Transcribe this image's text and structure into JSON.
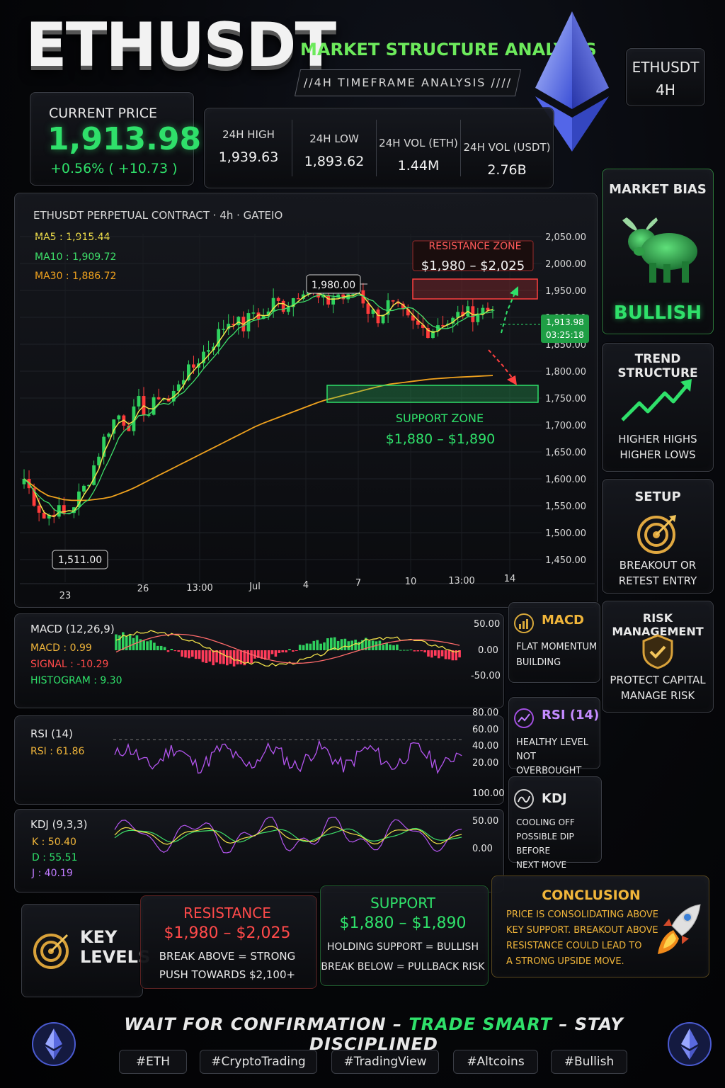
{
  "header": {
    "title": "ETHUSDT",
    "subtitle": "MARKET STRUCTURE ANALYSIS",
    "timeframe_banner": "//4H TIMEFRAME ANALYSIS ////",
    "pair_box": {
      "pair": "ETHUSDT",
      "interval": "4H"
    }
  },
  "price": {
    "label": "CURRENT PRICE",
    "value": "1,913.98",
    "change": "+0.56% ( +10.73 )"
  },
  "stats": [
    {
      "label": "24H HIGH",
      "value": "1,939.63"
    },
    {
      "label": "24H LOW",
      "value": "1,893.62"
    },
    {
      "label": "24H VOL (ETH)",
      "value": "1.44M"
    },
    {
      "label": "24H VOL (USDT)",
      "value": "2.76B"
    }
  ],
  "main_chart": {
    "header": "ETHUSDT PERPETUAL CONTRACT · 4h · GATEIO",
    "ma5": "MA5 : 1,915.44",
    "ma10": "MA10 : 1,909.72",
    "ma30": "MA30 : 1,886.72",
    "resistance_label": "RESISTANCE ZONE",
    "resistance_range": "$1,980 – $2,025",
    "support_label": "SUPPORT ZONE",
    "support_range": "$1,880 – $1,890",
    "high_callout": "1,980.00",
    "low_callout": "1,511.00",
    "price_tag": "1,913.98",
    "countdown": "03:25:18",
    "colors": {
      "up": "#2fd15e",
      "down": "#ff3b3b",
      "ma5": "#f2e14a",
      "ma10": "#3ee06a",
      "ma30": "#f0a21e"
    }
  },
  "chart_data": [
    {
      "type": "candlestick",
      "title": "ETHUSDT PERPETUAL CONTRACT · 4h · GATEIO",
      "x_tick_labels": [
        "23",
        "26",
        "13:00",
        "Jul",
        "4",
        "7",
        "10",
        "13:00",
        "14"
      ],
      "y_tick_labels": [
        "2,050.00",
        "2,000.00",
        "1,950.00",
        "1,900.00",
        "1,850.00",
        "1,800.00",
        "1,750.00",
        "1,700.00",
        "1,650.00",
        "1,600.00",
        "1,550.00",
        "1,500.00",
        "1,450.00"
      ],
      "ylim": [
        1450,
        2050
      ],
      "close_path": [
        1600,
        1560,
        1525,
        1545,
        1530,
        1560,
        1590,
        1640,
        1690,
        1720,
        1700,
        1740,
        1720,
        1760,
        1740,
        1790,
        1800,
        1830,
        1850,
        1880,
        1900,
        1880,
        1910,
        1900,
        1930,
        1920,
        1940,
        1960,
        1935,
        1925,
        1945,
        1930,
        1955,
        1915,
        1900,
        1925,
        1910,
        1890,
        1880,
        1875,
        1895,
        1890,
        1910,
        1905,
        1915,
        1914
      ],
      "ma30_path": [
        1600,
        1570,
        1560,
        1560,
        1565,
        1580,
        1600,
        1620,
        1640,
        1660,
        1680,
        1700,
        1715,
        1730,
        1745,
        1755,
        1765,
        1775,
        1780,
        1785,
        1788,
        1790,
        1792
      ],
      "annotations": {
        "high": 1980,
        "low": 1511,
        "last": 1913.98
      },
      "resistance_zone": [
        1980,
        2025
      ],
      "support_zone": [
        1880,
        1890
      ]
    },
    {
      "type": "line",
      "title": "MACD (12,26,9)",
      "series": [
        {
          "name": "MACD",
          "value": 0.99
        },
        {
          "name": "SIGNAL",
          "value": -10.29
        },
        {
          "name": "HISTOGRAM",
          "value": 9.3
        }
      ],
      "y_tick_labels": [
        "50.00",
        "0.00",
        "-50.00"
      ],
      "ylim": [
        -50,
        50
      ]
    },
    {
      "type": "line",
      "title": "RSI (14)",
      "series": [
        {
          "name": "RSI",
          "value": 61.86
        }
      ],
      "y_tick_labels": [
        "80.00",
        "60.00",
        "40.00",
        "20.00"
      ],
      "ylim": [
        20,
        80
      ]
    },
    {
      "type": "line",
      "title": "KDJ (9,3,3)",
      "series": [
        {
          "name": "K",
          "value": 50.4
        },
        {
          "name": "D",
          "value": 55.51
        },
        {
          "name": "J",
          "value": 40.19
        }
      ],
      "y_tick_labels": [
        "100.00",
        "50.00",
        "0.00"
      ],
      "ylim": [
        0,
        100
      ]
    }
  ],
  "indicators": {
    "macd": {
      "title": "MACD (12,26,9)",
      "macd": "MACD : 0.99",
      "signal": "SIGNAL : -10.29",
      "hist": "HISTOGRAM : 9.30",
      "card_title": "MACD",
      "card_text": [
        "FLAT MOMENTUM",
        "BUILDING"
      ]
    },
    "rsi": {
      "title": "RSI (14)",
      "rsi": "RSI : 61.86",
      "card_title": "RSI (14)",
      "card_text": [
        "HEALTHY LEVEL",
        "NOT OVERBOUGHT"
      ]
    },
    "kdj": {
      "title": "KDJ (9,3,3)",
      "k": "K : 50.40",
      "d": "D : 55.51",
      "j": "J : 40.19",
      "card_title": "KDJ",
      "card_text": [
        "COOLING OFF",
        "POSSIBLE DIP BEFORE",
        "NEXT MOVE"
      ]
    }
  },
  "sidebar": {
    "market_bias": {
      "title": "MARKET BIAS",
      "value": "BULLISH"
    },
    "trend": {
      "title": "TREND STRUCTURE",
      "lines": [
        "HIGHER HIGHS",
        "HIGHER LOWS"
      ]
    },
    "setup": {
      "title": "SETUP",
      "lines": [
        "BREAKOUT OR",
        "RETEST ENTRY"
      ]
    },
    "risk": {
      "title": "RISK MANAGEMENT",
      "lines": [
        "PROTECT CAPITAL",
        "MANAGE RISK"
      ]
    }
  },
  "key_levels": {
    "title_1": "KEY",
    "title_2": "LEVELS",
    "resistance": {
      "title": "RESISTANCE",
      "range": "$1,980 – $2,025",
      "lines": [
        "BREAK ABOVE = STRONG",
        "PUSH TOWARDS $2,100+"
      ]
    },
    "support": {
      "title": "SUPPORT",
      "range": "$1,880 – $1,890",
      "lines": [
        "HOLDING SUPPORT = BULLISH",
        "BREAK BELOW = PULLBACK RISK"
      ]
    },
    "conclusion": {
      "title": "CONCLUSION",
      "lines": [
        "PRICE IS CONSOLIDATING ABOVE",
        "KEY SUPPORT. BREAKOUT ABOVE",
        "RESISTANCE COULD LEAD TO",
        "A STRONG UPSIDE MOVE."
      ]
    }
  },
  "footer": {
    "slogan_1": "WAIT FOR CONFIRMATION –",
    "slogan_2": "TRADE SMART",
    "slogan_3": "– STAY DISCIPLINED",
    "tags": [
      "#ETH",
      "#CryptoTrading",
      "#TradingView",
      "#Altcoins",
      "#Bullish"
    ]
  }
}
